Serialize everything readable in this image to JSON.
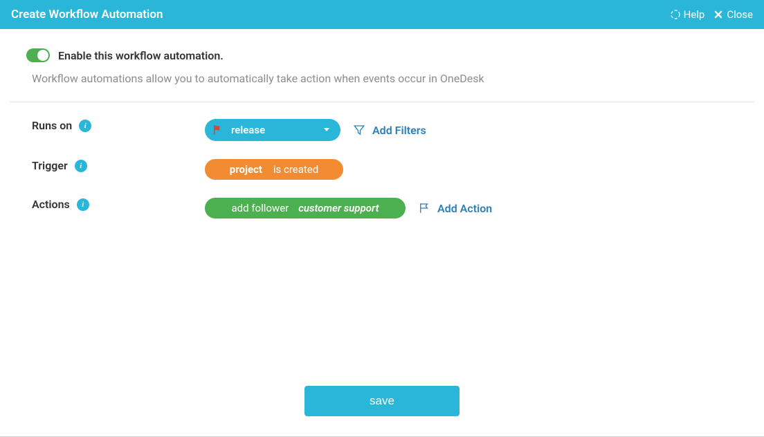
{
  "header": {
    "title": "Create Workflow Automation",
    "help_label": "Help",
    "close_label": "Close"
  },
  "enable": {
    "label": "Enable this workflow automation."
  },
  "description": "Workflow automations allow you to automatically take action when events occur in OneDesk",
  "rows": {
    "runs_on": {
      "label": "Runs on",
      "selected": "release",
      "add_filters": "Add Filters"
    },
    "trigger": {
      "label": "Trigger",
      "strong": "project",
      "rest": "is created"
    },
    "actions": {
      "label": "Actions",
      "action_label": "add follower",
      "action_value": "customer support",
      "add_action": "Add Action"
    }
  },
  "save_label": "save",
  "info_char": "i"
}
